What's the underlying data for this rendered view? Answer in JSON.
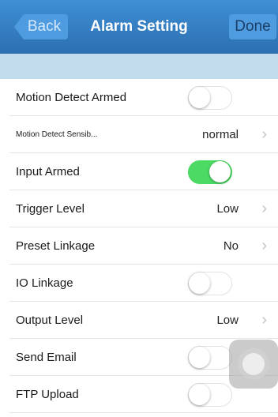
{
  "header": {
    "back_label": "Back",
    "title": "Alarm Setting",
    "done_label": "Done"
  },
  "rows": [
    {
      "label": "Motion Detect Armed",
      "type": "toggle",
      "on": false
    },
    {
      "label": "Motion Detect Sensib...",
      "type": "value",
      "value": "normal"
    },
    {
      "label": "Input Armed",
      "type": "toggle",
      "on": true
    },
    {
      "label": "Trigger Level",
      "type": "value",
      "value": "Low"
    },
    {
      "label": "Preset Linkage",
      "type": "value",
      "value": "No"
    },
    {
      "label": "IO Linkage",
      "type": "toggle",
      "on": false
    },
    {
      "label": "Output Level",
      "type": "value",
      "value": "Low"
    },
    {
      "label": "Send Email",
      "type": "toggle",
      "on": false
    },
    {
      "label": "FTP Upload",
      "type": "toggle",
      "on": false
    }
  ],
  "colors": {
    "nav": "#2c6fb1",
    "toggle_on": "#4cd964",
    "subheader": "#c3dced"
  },
  "icons": {
    "chevron": "chevron-right-icon",
    "assistive": "assistive-touch-icon"
  }
}
